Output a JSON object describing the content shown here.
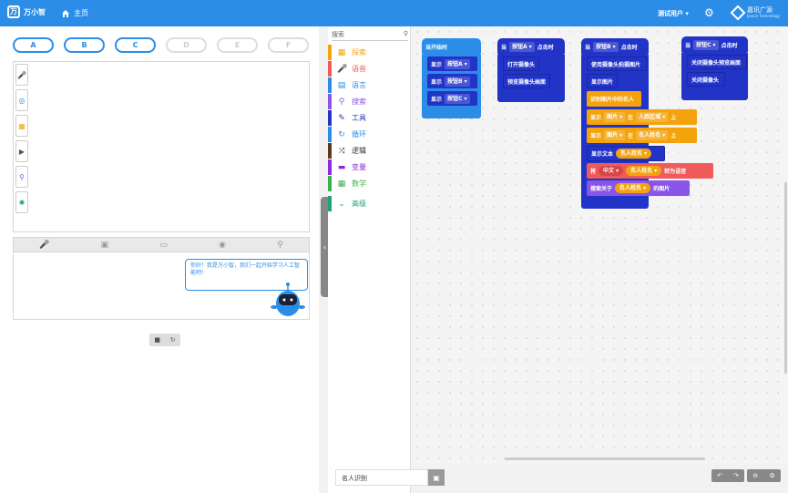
{
  "header": {
    "logo_mark": "万",
    "logo_text": "万小智",
    "home_label": "主页",
    "user_label": "测试用户",
    "gear_icon": "gear-icon",
    "brand_name": "嘉讯广源",
    "brand_sub": "Jiaxun Technology"
  },
  "left": {
    "buttons": [
      "A",
      "B",
      "C",
      "D",
      "E",
      "F"
    ],
    "side_tools": [
      "mic-icon",
      "voice-icon",
      "image-icon",
      "video-icon",
      "search-icon",
      "bulb-icon"
    ],
    "chat_tools": [
      "mic-icon",
      "text-icon",
      "image-icon",
      "face-icon",
      "search-icon"
    ],
    "bubble": "你好！我是万小智，我们一起开始学习人工智能吧!",
    "stop_icon": "stop-icon",
    "refresh_icon": "refresh-icon"
  },
  "categories": {
    "search_placeholder": "搜索",
    "items": [
      {
        "label": "探索",
        "color": "#f5a30c"
      },
      {
        "label": "语音",
        "color": "#ef5b5b"
      },
      {
        "label": "语言",
        "color": "#2b8de8"
      },
      {
        "label": "搜索",
        "color": "#8a55e6"
      },
      {
        "label": "工具",
        "color": "#2233c8"
      },
      {
        "label": "循环",
        "color": "#2b8de8"
      },
      {
        "label": "逻辑",
        "color": "#5b3a1c"
      },
      {
        "label": "变量",
        "color": "#8a2be2"
      },
      {
        "label": "数学",
        "color": "#3ab04a"
      },
      {
        "label": "高级",
        "color": "#1fa37a"
      }
    ]
  },
  "blocks": {
    "start": {
      "title": "当开始时",
      "rows": [
        {
          "kw": "显示",
          "btn": "按钮A"
        },
        {
          "kw": "显示",
          "btn": "按钮B"
        },
        {
          "kw": "显示",
          "btn": "按钮C"
        }
      ]
    },
    "groupA": {
      "when": "当",
      "btn": "按钮A",
      "event": "点击时",
      "rows": [
        "打开摄像头",
        "预览摄像头画面"
      ]
    },
    "groupB": {
      "when": "当",
      "btn": "按钮B",
      "event": "点击时",
      "r1": "使用摄像头拍摄图片",
      "r2": "显示图片",
      "r3": "识别图片中的名人",
      "r4": {
        "kw": "显示",
        "a": "图片",
        "in": "在",
        "b": "人脸区域",
        "up": "上"
      },
      "r5": {
        "kw": "显示",
        "a": "图片",
        "in": "在",
        "b": "名人姓名",
        "up": "上"
      },
      "r6": {
        "kw": "显示文本",
        "v": "名人姓名"
      },
      "r7": {
        "kw": "将",
        "lang": "中文",
        "v": "名人姓名",
        "to": "转为语音"
      },
      "r8": {
        "kw": "搜索关于",
        "v": "名人姓名",
        "suffix": "的图片"
      }
    },
    "groupC": {
      "when": "当",
      "btn": "按钮C",
      "event": "点击时",
      "rows": [
        "关闭摄像头预览画面",
        "关闭摄像头"
      ]
    }
  },
  "footer": {
    "filename": "名人识别",
    "save_icon": "save-icon",
    "undo_icon": "undo-icon",
    "redo_icon": "redo-icon",
    "zoom_out_icon": "zoom-out-icon",
    "zoom_in_icon": "zoom-in-icon"
  }
}
